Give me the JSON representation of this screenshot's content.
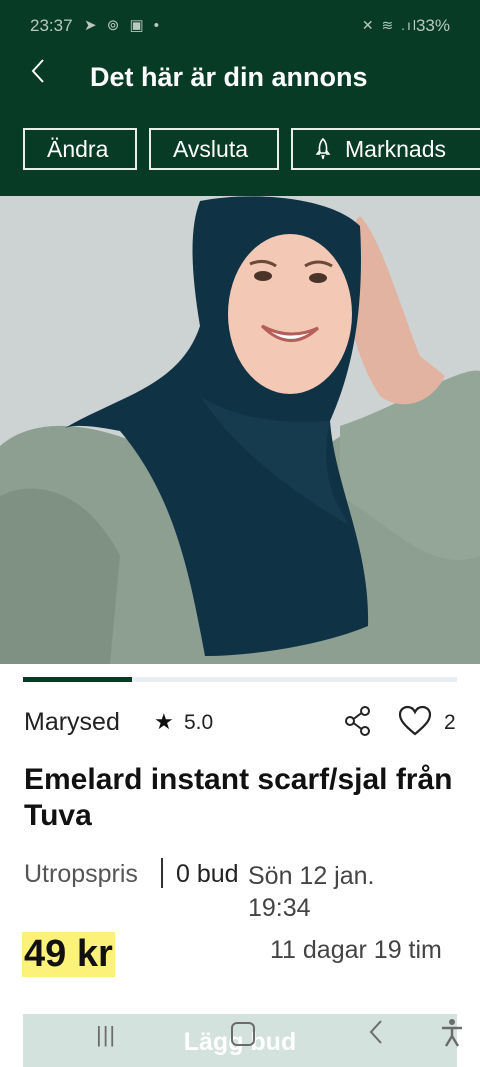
{
  "status_bar": {
    "time": "23:37",
    "left_icons": "➤ ⊚ ▣ •",
    "right_icons": "✕ ≋ .ıl",
    "battery": "33%"
  },
  "header": {
    "title": "Det här är din annons",
    "back_icon": "chevron-left-icon"
  },
  "actions": [
    {
      "label": "Ändra"
    },
    {
      "label": "Avsluta"
    },
    {
      "label": "Marknads",
      "icon": "rocket-icon"
    }
  ],
  "gallery": {
    "progress": 0.25
  },
  "listing": {
    "seller": "Marysed",
    "rating": "5.0",
    "favorites": "2",
    "title": "Emelard instant scarf/sjal från Tuva",
    "price_type": "Utropspris",
    "bids": "0 bud",
    "end_date": "Sön 12 jan. 19:34",
    "price": "49 kr",
    "time_left": "11 dagar 19 tim"
  },
  "bid_button": {
    "label": "Lägg bud"
  },
  "colors": {
    "brand_green": "#073b26",
    "price_highlight": "#fcf27a"
  }
}
